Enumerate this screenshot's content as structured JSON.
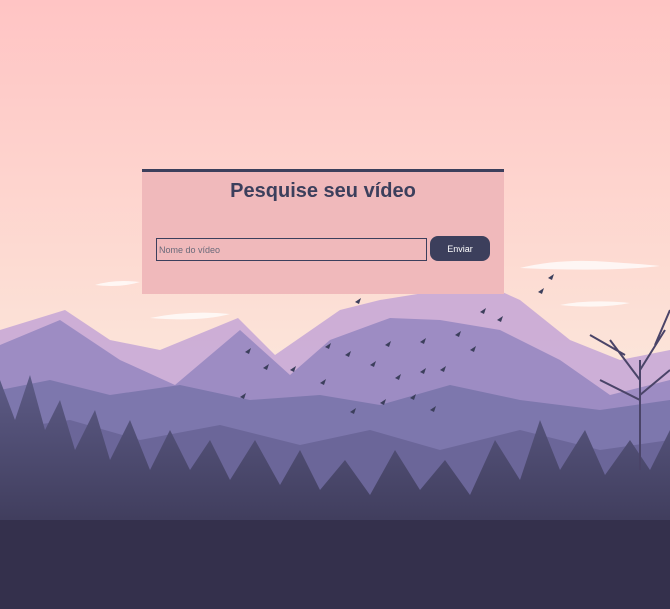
{
  "page": {
    "colors": {
      "accent": "#3c3f5c",
      "card_bg": "#f0b9bb",
      "sky_top": "#ffc4c4",
      "sky_bottom": "#fce3d6"
    }
  },
  "search_card": {
    "title": "Pesquise seu vídeo",
    "input": {
      "placeholder": "Nome do vídeo",
      "value": ""
    },
    "submit_label": "Enviar"
  },
  "background": {
    "icons": [
      "mountain-landscape",
      "bird-flock",
      "forest",
      "tree-silhouette"
    ]
  }
}
